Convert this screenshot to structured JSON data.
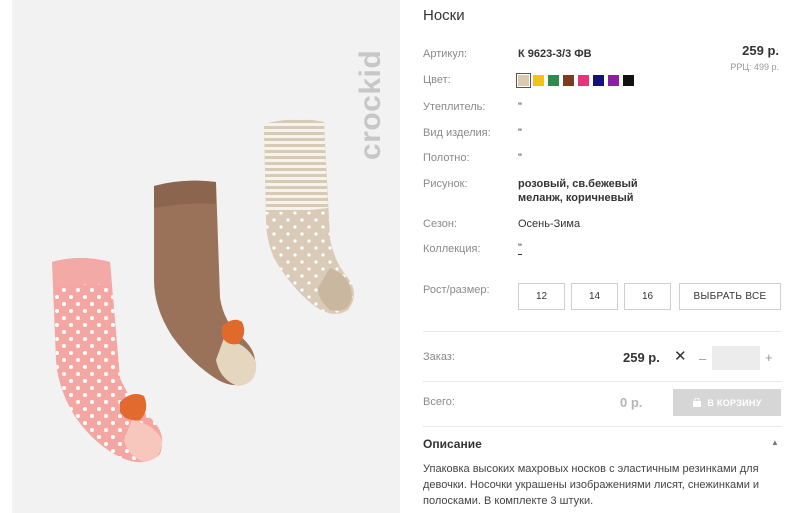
{
  "brand": {
    "logo_text": "crockid"
  },
  "product": {
    "title": "Носки",
    "price": "259 р.",
    "rrc_price": "РРЦ: 499 р."
  },
  "attributes": {
    "article_label": "Артикул:",
    "article_value": "К 9623-3/3 ФВ",
    "color_label": "Цвет:",
    "filler_label": "Утеплитель:",
    "filler_value": "\"",
    "type_label": "Вид изделия:",
    "type_value": "\"",
    "fabric_label": "Полотно:",
    "fabric_value": "\"",
    "pattern_label": "Рисунок:",
    "pattern_value_line1": "розовый, св.бежевый",
    "pattern_value_line2": "меланж, коричневый",
    "season_label": "Сезон:",
    "season_value": "Осень-Зима",
    "collection_label": "Коллекция:",
    "collection_value": "\""
  },
  "colors": [
    {
      "name": "beige",
      "hex": "#d9cbb0",
      "selected": true
    },
    {
      "name": "yellow",
      "hex": "#f2c316"
    },
    {
      "name": "green",
      "hex": "#2f8a4c"
    },
    {
      "name": "brown",
      "hex": "#7a3b1e"
    },
    {
      "name": "pink",
      "hex": "#e8337a"
    },
    {
      "name": "navy",
      "hex": "#12137a"
    },
    {
      "name": "purple",
      "hex": "#8a1fa8"
    },
    {
      "name": "black",
      "hex": "#111111"
    }
  ],
  "sizes": {
    "label": "Рост/размер:",
    "options": [
      "12",
      "14",
      "16"
    ],
    "select_all": "ВЫБРАТЬ ВСЕ"
  },
  "order": {
    "label": "Заказ:",
    "price": "259 р.",
    "times": "✕",
    "minus": "–",
    "plus": "+",
    "quantity": ""
  },
  "total": {
    "label": "Всего:",
    "value": "0 р.",
    "cart_button": "В КОРЗИНУ"
  },
  "description": {
    "title": "Описание",
    "text": "Упаковка высоких махровых носков с эластичным резинками для девочки. Носочки украшены изображениями лисят, снежинками и полосками. В комплекте 3 штуки."
  }
}
